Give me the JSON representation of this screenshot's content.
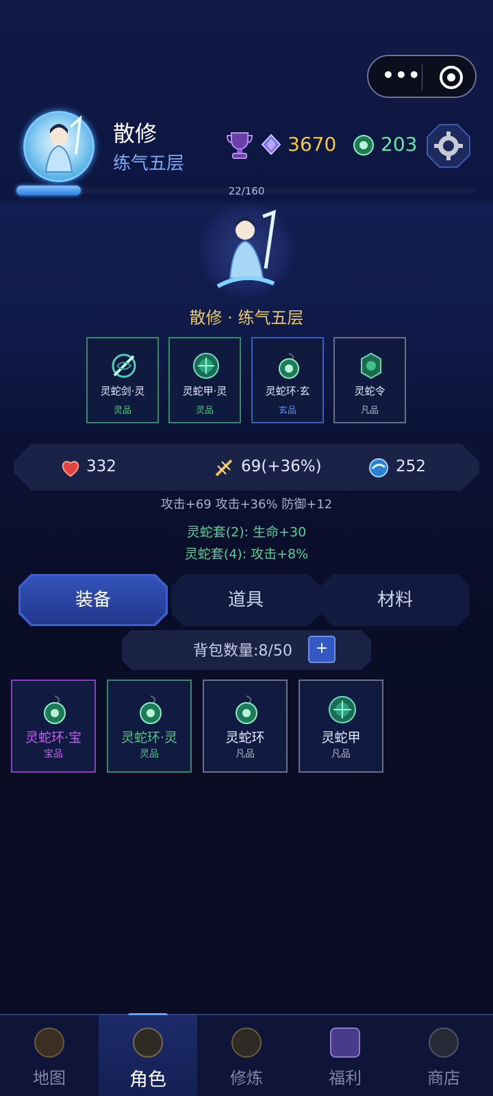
{
  "header": {
    "player_name": "散修",
    "realm": "练气五层",
    "spirit_stones": "3670",
    "jade": "203",
    "exp_text": "22/160",
    "exp_progress": 0.1375
  },
  "hero": {
    "title": "散修 · 练气五层"
  },
  "equipped": [
    {
      "name": "灵蛇剑·灵",
      "quality": "灵品",
      "icon": "sword-icon"
    },
    {
      "name": "灵蛇甲·灵",
      "quality": "灵品",
      "icon": "armor-icon"
    },
    {
      "name": "灵蛇环·玄",
      "quality": "玄品",
      "icon": "ring-icon"
    },
    {
      "name": "灵蛇令",
      "quality": "凡品",
      "icon": "token-icon"
    }
  ],
  "stats": {
    "hp": "332",
    "attack": "69(+36%)",
    "defense": "252",
    "bonus_line": "攻击+69 攻击+36% 防御+12",
    "set_bonus_2": "灵蛇套(2): 生命+30",
    "set_bonus_4": "灵蛇套(4): 攻击+8%"
  },
  "tabs": [
    "装备",
    "道具",
    "材料"
  ],
  "active_tab": "装备",
  "bag": {
    "label": "背包数量:8/50",
    "add_label": "+"
  },
  "inventory": [
    {
      "name": "灵蛇环·宝",
      "quality": "宝品",
      "color": "#c365f0"
    },
    {
      "name": "灵蛇环·灵",
      "quality": "灵品",
      "color": "#59c48c"
    },
    {
      "name": "灵蛇环",
      "quality": "凡品",
      "color": "#e6ecff"
    },
    {
      "name": "灵蛇甲",
      "quality": "凡品",
      "color": "#e6ecff"
    }
  ],
  "nav": [
    {
      "label": "地图",
      "icon": "map-icon"
    },
    {
      "label": "角色",
      "icon": "character-icon"
    },
    {
      "label": "修炼",
      "icon": "cultivate-icon"
    },
    {
      "label": "福利",
      "icon": "gift-icon"
    },
    {
      "label": "商店",
      "icon": "shop-icon"
    }
  ],
  "active_nav": "角色",
  "colors": {
    "accent_blue": "#3d5fd0",
    "gold": "#f4c64a",
    "jade": "#6fe3a6",
    "quality_ling": "#59c48c",
    "quality_xuan": "#5f8df0",
    "quality_bao": "#c365f0"
  }
}
